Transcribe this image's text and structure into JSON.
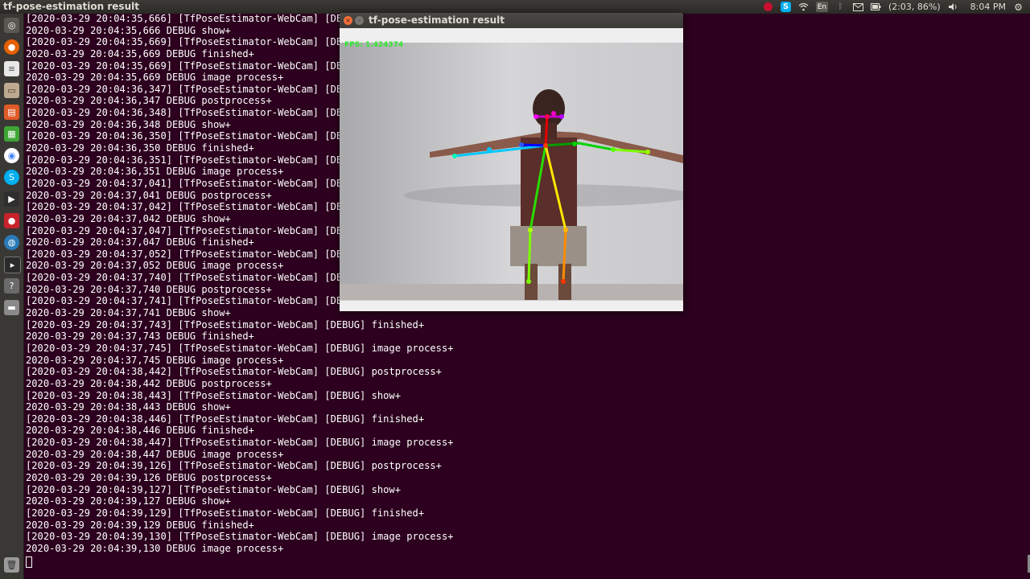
{
  "topbar": {
    "app_title": "tf-pose-estimation result",
    "battery_text": "(2:03, 86%)",
    "clock": "8:04 PM",
    "keyboard_layout": "En",
    "tray_icons": [
      "record-icon",
      "skype-icon",
      "wifi-icon",
      "keyboard-layout-icon",
      "bluetooth-icon",
      "mail-icon",
      "battery-icon",
      "volume-icon"
    ]
  },
  "launcher": {
    "icons": [
      "dash-icon",
      "firefox-icon",
      "text-editor-icon",
      "files-icon",
      "document-viewer-icon",
      "spreadsheet-icon",
      "chrome-icon",
      "skype-icon",
      "video-player-icon",
      "screen-recorder-icon",
      "browser-icon",
      "terminal-icon",
      "help-icon",
      "drive-icon",
      "trash-icon"
    ]
  },
  "terminal": {
    "lines": [
      "[2020-03-29 20:04:35,666] [TfPoseEstimator-WebCam] [DEBUG] show+",
      "2020-03-29 20:04:35,666 DEBUG show+",
      "[2020-03-29 20:04:35,669] [TfPoseEstimator-WebCam] [DEBUG] finished+",
      "2020-03-29 20:04:35,669 DEBUG finished+",
      "[2020-03-29 20:04:35,669] [TfPoseEstimator-WebCam] [DEBUG] image process+",
      "2020-03-29 20:04:35,669 DEBUG image process+",
      "[2020-03-29 20:04:36,347] [TfPoseEstimator-WebCam] [DEBUG] postprocess+",
      "2020-03-29 20:04:36,347 DEBUG postprocess+",
      "[2020-03-29 20:04:36,348] [TfPoseEstimator-WebCam] [DEBUG] show+",
      "2020-03-29 20:04:36,348 DEBUG show+",
      "[2020-03-29 20:04:36,350] [TfPoseEstimator-WebCam] [DEBUG] finished+",
      "2020-03-29 20:04:36,350 DEBUG finished+",
      "[2020-03-29 20:04:36,351] [TfPoseEstimator-WebCam] [DEBUG] image process+",
      "2020-03-29 20:04:36,351 DEBUG image process+",
      "[2020-03-29 20:04:37,041] [TfPoseEstimator-WebCam] [DEBUG] postprocess+",
      "2020-03-29 20:04:37,041 DEBUG postprocess+",
      "[2020-03-29 20:04:37,042] [TfPoseEstimator-WebCam] [DEBUG] show+",
      "2020-03-29 20:04:37,042 DEBUG show+",
      "[2020-03-29 20:04:37,047] [TfPoseEstimator-WebCam] [DEBUG] finished+",
      "2020-03-29 20:04:37,047 DEBUG finished+",
      "[2020-03-29 20:04:37,052] [TfPoseEstimator-WebCam] [DEBUG] image process+",
      "2020-03-29 20:04:37,052 DEBUG image process+",
      "[2020-03-29 20:04:37,740] [TfPoseEstimator-WebCam] [DEBUG] postprocess+",
      "2020-03-29 20:04:37,740 DEBUG postprocess+",
      "[2020-03-29 20:04:37,741] [TfPoseEstimator-WebCam] [DEBUG] show+",
      "2020-03-29 20:04:37,741 DEBUG show+",
      "[2020-03-29 20:04:37,743] [TfPoseEstimator-WebCam] [DEBUG] finished+",
      "2020-03-29 20:04:37,743 DEBUG finished+",
      "[2020-03-29 20:04:37,745] [TfPoseEstimator-WebCam] [DEBUG] image process+",
      "2020-03-29 20:04:37,745 DEBUG image process+",
      "[2020-03-29 20:04:38,442] [TfPoseEstimator-WebCam] [DEBUG] postprocess+",
      "2020-03-29 20:04:38,442 DEBUG postprocess+",
      "[2020-03-29 20:04:38,443] [TfPoseEstimator-WebCam] [DEBUG] show+",
      "2020-03-29 20:04:38,443 DEBUG show+",
      "[2020-03-29 20:04:38,446] [TfPoseEstimator-WebCam] [DEBUG] finished+",
      "2020-03-29 20:04:38,446 DEBUG finished+",
      "[2020-03-29 20:04:38,447] [TfPoseEstimator-WebCam] [DEBUG] image process+",
      "2020-03-29 20:04:38,447 DEBUG image process+",
      "[2020-03-29 20:04:39,126] [TfPoseEstimator-WebCam] [DEBUG] postprocess+",
      "2020-03-29 20:04:39,126 DEBUG postprocess+",
      "[2020-03-29 20:04:39,127] [TfPoseEstimator-WebCam] [DEBUG] show+",
      "2020-03-29 20:04:39,127 DEBUG show+",
      "[2020-03-29 20:04:39,129] [TfPoseEstimator-WebCam] [DEBUG] finished+",
      "2020-03-29 20:04:39,129 DEBUG finished+",
      "[2020-03-29 20:04:39,130] [TfPoseEstimator-WebCam] [DEBUG] image process+",
      "2020-03-29 20:04:39,130 DEBUG image process+"
    ]
  },
  "pose_window": {
    "title": "tf-pose-estimation result",
    "fps_text": "FPS: 1.424374",
    "close_glyph": "×",
    "minimize_glyph": "–"
  },
  "colors": {
    "terminal_bg": "#2c001e",
    "terminal_fg": "#ffffff",
    "fps_text": "#2ee82e",
    "close_button": "#f36f3b"
  }
}
